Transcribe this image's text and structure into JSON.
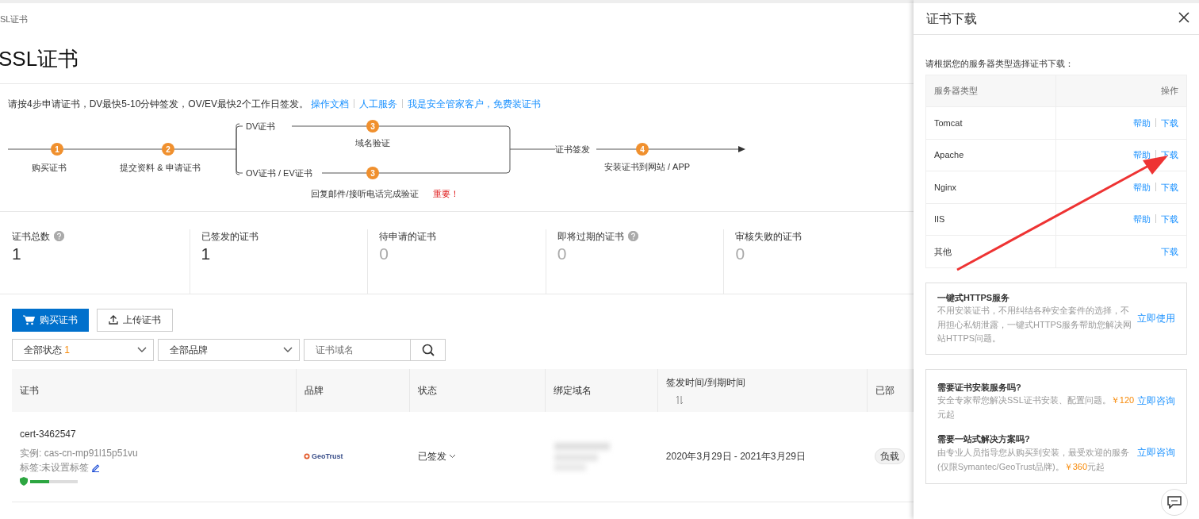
{
  "breadcrumb": "SL证书",
  "title": "SSL证书",
  "intro": {
    "text": "请按4步申请证书，DV最快5-10分钟签发，OV/EV最快2个工作日签发。",
    "links": [
      "操作文档",
      "人工服务",
      "我是安全管家客户，免费装证书"
    ]
  },
  "flow": {
    "steps": [
      {
        "number": "1",
        "label": "购买证书"
      },
      {
        "number": "2",
        "label": "提交资料 & 申请证书"
      }
    ],
    "branches": [
      {
        "label": "DV证书",
        "number": "3",
        "note": "域名验证"
      },
      {
        "label": "OV证书 / EV证书",
        "number": "3",
        "note": "回复邮件/接听电话完成验证",
        "warning": "重要！"
      }
    ],
    "issue_label": "证书签发",
    "final_step": {
      "number": "4",
      "label": "安装证书到网站 / APP"
    }
  },
  "stats": [
    {
      "label": "证书总数",
      "value": "1",
      "help": true,
      "muted": false
    },
    {
      "label": "已签发的证书",
      "value": "1",
      "help": false,
      "muted": false
    },
    {
      "label": "待申请的证书",
      "value": "0",
      "help": false,
      "muted": true
    },
    {
      "label": "即将过期的证书",
      "value": "0",
      "help": true,
      "muted": true
    },
    {
      "label": "审核失败的证书",
      "value": "0",
      "help": false,
      "muted": true
    }
  ],
  "actions": [
    {
      "kind": "primary",
      "label": "购买证书"
    },
    {
      "kind": "upload",
      "label": "上传证书"
    }
  ],
  "filters": {
    "status": {
      "value": "全部状态",
      "count": "1"
    },
    "brand": {
      "value": "全部品牌"
    },
    "search": {
      "placeholder": "证书域名"
    }
  },
  "table": {
    "columns": [
      "证书",
      "品牌",
      "状态",
      "绑定域名",
      "签发时间/到期时间",
      "已部"
    ],
    "rows": [
      {
        "name": "cert-3462547",
        "instance": "实例: cas-cn-mp91l15p51vu",
        "tag": "标签:未设置标签",
        "level": 0.4,
        "brand": "GeoTrust",
        "status": "已签发",
        "dates": "2020年3月29日 - 2021年3月29日",
        "deployed": "负载"
      }
    ]
  },
  "drawer": {
    "title": "证书下载",
    "prompt": "请根据您的服务器类型选择证书下载：",
    "columns": [
      "服务器类型",
      "操作"
    ],
    "servers": [
      {
        "name": "Tomcat",
        "actions": [
          "帮助",
          "下载"
        ]
      },
      {
        "name": "Apache",
        "actions": [
          "帮助",
          "下载"
        ]
      },
      {
        "name": "Nginx",
        "actions": [
          "帮助",
          "下载"
        ]
      },
      {
        "name": "IIS",
        "actions": [
          "帮助",
          "下载"
        ]
      },
      {
        "name": "其他",
        "actions": [
          "下载"
        ]
      }
    ],
    "https_card": {
      "title": "一键式HTTPS服务",
      "text": "不用安装证书，不用纠结各种安全套件的选择，不用担心私钥泄露，一键式HTTPS服务帮助您解决网站HTTPS问题。",
      "action": "立即使用"
    },
    "services": [
      {
        "title": "需要证书安装服务吗?",
        "text": "安全专家帮您解决SSL证书安装、配置问题。",
        "price": "￥120",
        "tail": "元起",
        "action": "立即咨询"
      },
      {
        "title": "需要一站式解决方案吗?",
        "text": "由专业人员指导您从购买到安装，最受欢迎的服务(仅限Symantec/GeoTrust品牌)。",
        "price": "￥360",
        "tail": "元起",
        "action": "立即咨询"
      }
    ]
  }
}
